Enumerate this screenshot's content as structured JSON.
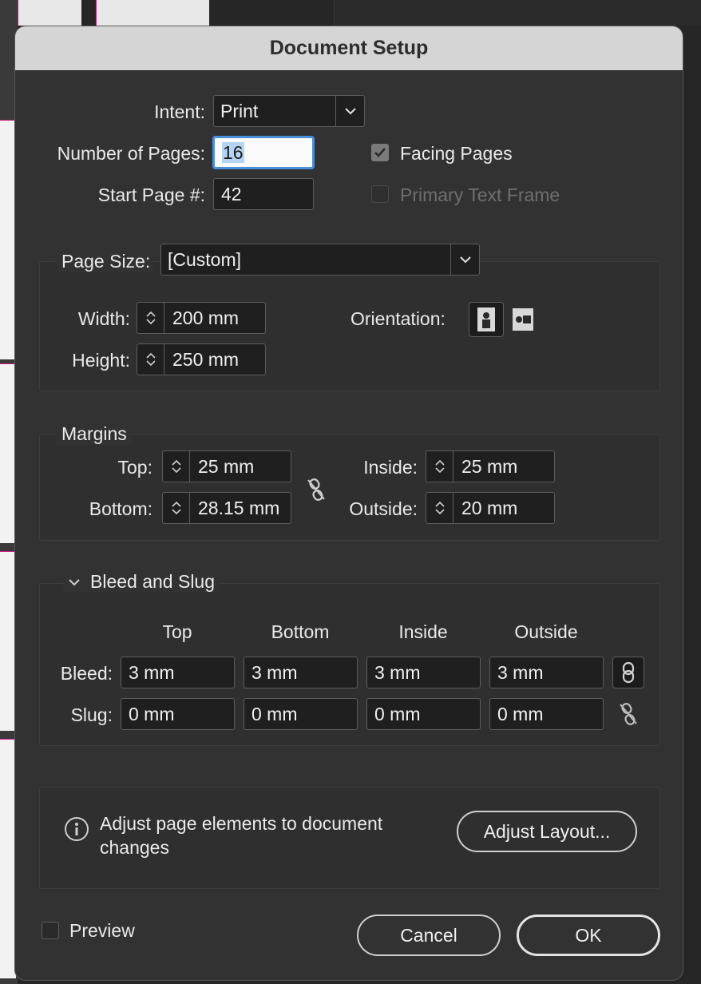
{
  "dialog": {
    "title": "Document Setup"
  },
  "intent": {
    "label": "Intent:",
    "value": "Print"
  },
  "pages": {
    "count_label": "Number of Pages:",
    "count_value": "16",
    "start_label": "Start Page #:",
    "start_value": "42",
    "facing_label": "Facing Pages",
    "facing_checked": true,
    "primary_frame_label": "Primary Text Frame",
    "primary_frame_checked": false
  },
  "page_size": {
    "label": "Page Size:",
    "value": "[Custom]",
    "width_label": "Width:",
    "width_value": "200 mm",
    "height_label": "Height:",
    "height_value": "250 mm",
    "orientation_label": "Orientation:"
  },
  "margins": {
    "title": "Margins",
    "top_label": "Top:",
    "top_value": "25 mm",
    "bottom_label": "Bottom:",
    "bottom_value": "28.15 mm",
    "inside_label": "Inside:",
    "inside_value": "25 mm",
    "outside_label": "Outside:",
    "outside_value": "20 mm"
  },
  "bleed_slug": {
    "title": "Bleed and Slug",
    "columns": [
      "Top",
      "Bottom",
      "Inside",
      "Outside"
    ],
    "bleed_label": "Bleed:",
    "bleed_values": [
      "3 mm",
      "3 mm",
      "3 mm",
      "3 mm"
    ],
    "slug_label": "Slug:",
    "slug_values": [
      "0 mm",
      "0 mm",
      "0 mm",
      "0 mm"
    ]
  },
  "adjust": {
    "message": "Adjust page elements to document changes",
    "button": "Adjust Layout..."
  },
  "footer": {
    "preview_label": "Preview",
    "preview_checked": false,
    "cancel": "Cancel",
    "ok": "OK"
  },
  "colors": {
    "focus": "#4a8fd9",
    "dialog_bg": "#323232",
    "titlebar": "#d5d5d5"
  },
  "icons": [
    "chevron-down-icon",
    "checkmark-icon",
    "portrait-icon",
    "landscape-icon",
    "unlink-chain-icon",
    "link-chain-icon",
    "info-icon",
    "disclosure-triangle-icon"
  ]
}
